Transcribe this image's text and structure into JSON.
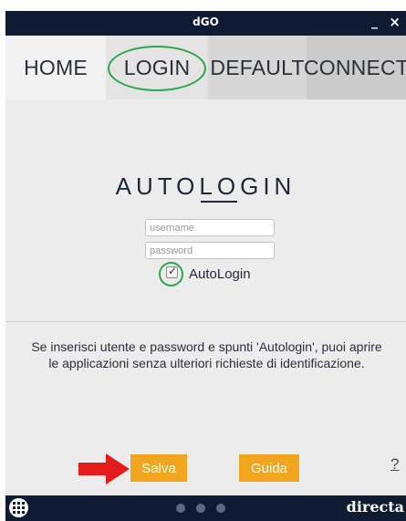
{
  "window": {
    "title": "dGO",
    "minimize_label": "_",
    "close_label": "×"
  },
  "tabs": [
    {
      "label": "HOME",
      "active": false
    },
    {
      "label": "LOGIN",
      "active": true
    },
    {
      "label": "DEFAULT",
      "active": false
    },
    {
      "label": "CONNECT",
      "active": false
    }
  ],
  "login": {
    "title": "AUTOLOGIN",
    "username_placeholder": "username",
    "username_value": "",
    "password_placeholder": "password",
    "password_value": "",
    "autologin_label": "AutoLogin",
    "autologin_checked": true,
    "check_glyph": "✓",
    "description": "Se inserisci utente e password e spunti 'Autologin', puoi aprire le applicazioni senza ulteriori richieste di identificazione."
  },
  "actions": {
    "save_label": "Salva",
    "help_label": "Guida",
    "question_label": "?"
  },
  "footer": {
    "brand": "directa",
    "page_dots": 3,
    "apps_icon": "grid-icon"
  },
  "colors": {
    "titlebar": "#0f1a33",
    "accent_orange": "#f2a51f",
    "highlight_green": "#2aa84a",
    "arrow_red": "#e31b1b"
  }
}
